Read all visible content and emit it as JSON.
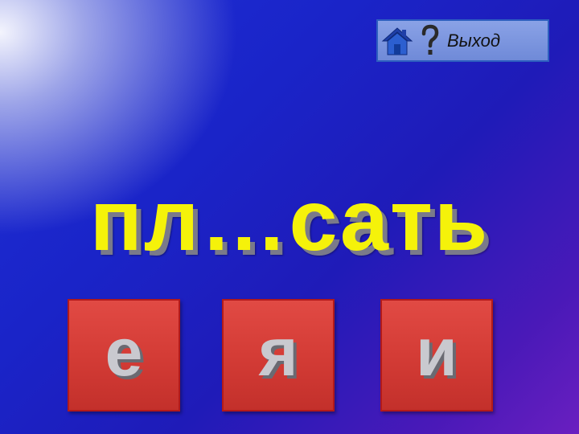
{
  "nav": {
    "home_icon": "home-icon",
    "help_icon": "question-icon",
    "exit_label": "Выход"
  },
  "word": "пл…сать",
  "options": [
    {
      "letter": "е"
    },
    {
      "letter": "я"
    },
    {
      "letter": "и"
    }
  ],
  "colors": {
    "word": "#f5f20a",
    "tile": "#d43c36",
    "tile_border": "#b31a1a",
    "nav_bg": "#7b93dd",
    "background": "#1e2fd6"
  }
}
